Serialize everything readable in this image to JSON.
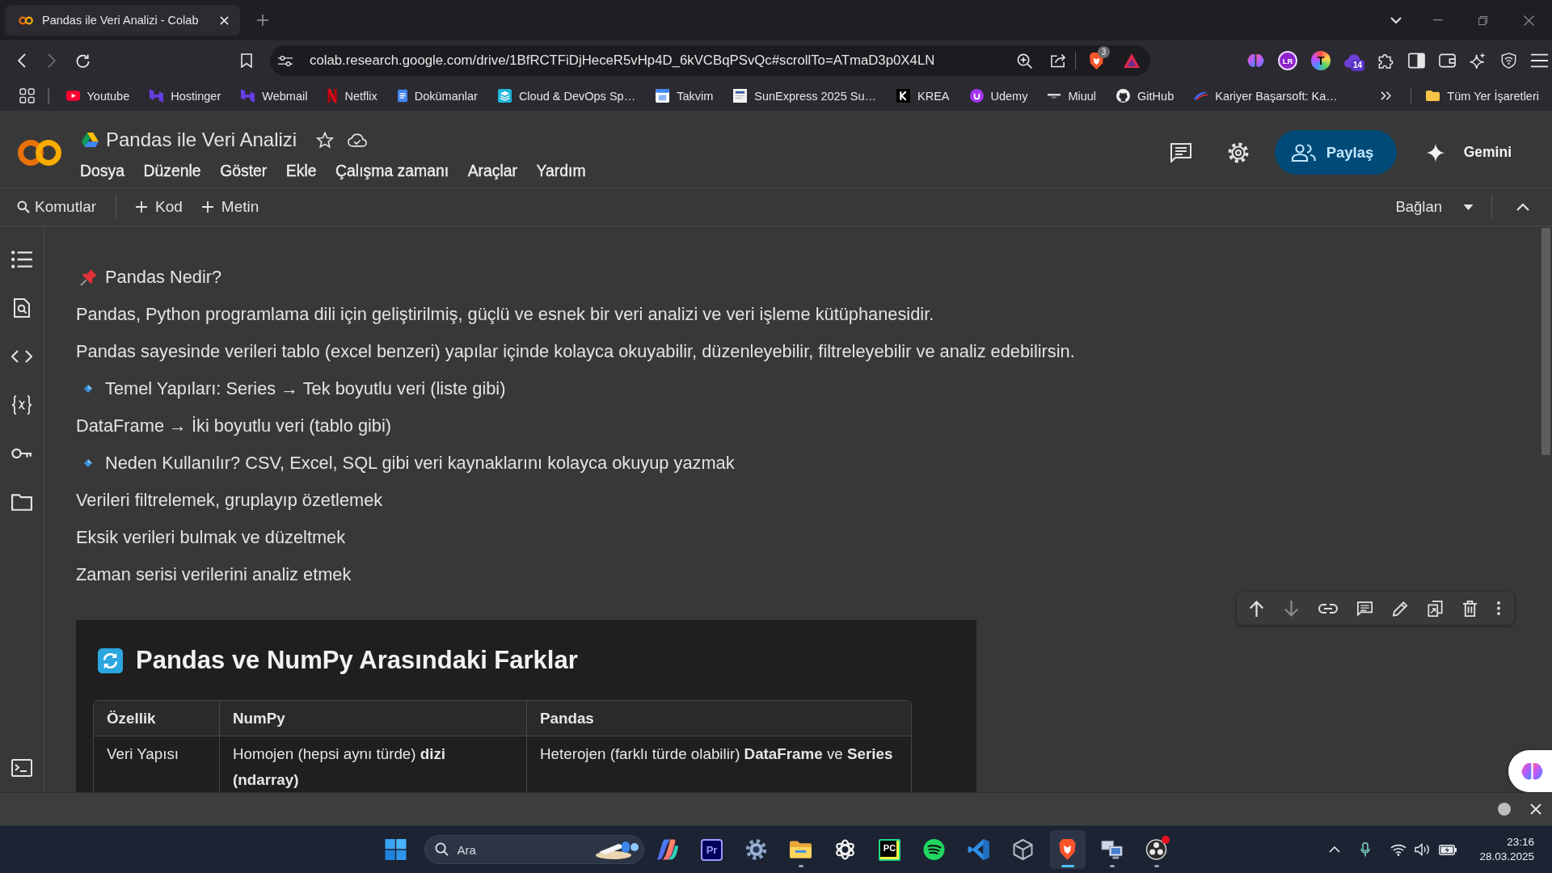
{
  "browser": {
    "tabs": [
      {
        "title": "Pandas ile Veri Analizi - Colab",
        "selected": true
      }
    ],
    "can_go_forward": false,
    "address_bar": {
      "value": "colab.research.google.com/drive/1BfRCTFiDjHeceR5vHp4D_6kVCBqPSvQc#scrollTo=ATmaD3p0X4LN"
    },
    "shields_badge": "3",
    "extensions": [
      {
        "kind": "brain"
      },
      {
        "kind": "ring-monogram",
        "label": "LR"
      },
      {
        "kind": "gradient-monogram",
        "label": "T"
      },
      {
        "kind": "cloud",
        "badge": "14"
      }
    ],
    "bookmarks": [
      {
        "label": "Youtube",
        "kind": "play"
      },
      {
        "label": "Hostinger",
        "kind": "h-mark"
      },
      {
        "label": "Webmail",
        "kind": "h-mark"
      },
      {
        "label": "Netflix",
        "kind": "n-mark"
      },
      {
        "label": "Dokümanlar",
        "kind": "document"
      },
      {
        "label": "Cloud & DevOps Sp…",
        "kind": "layers"
      },
      {
        "label": "Takvim",
        "kind": "calendar"
      },
      {
        "label": "SunExpress 2025 Su…",
        "kind": "page"
      },
      {
        "label": "KREA",
        "kind": "k-tile"
      },
      {
        "label": "Udemy",
        "kind": "u-disc"
      },
      {
        "label": "Miuul",
        "kind": "dash"
      },
      {
        "label": "GitHub",
        "kind": "cat"
      },
      {
        "label": "Kariyer Başarsoft: Ka…",
        "kind": "swoosh"
      }
    ],
    "all_bookmarks_folder": "Tüm Yer İşaretleri"
  },
  "notebook": {
    "title": "Pandas ile Veri Analizi",
    "starred": false,
    "menu": [
      "Dosya",
      "Düzenle",
      "Göster",
      "Ekle",
      "Çalışma zamanı",
      "Araçlar",
      "Yardım"
    ],
    "share_button": "Paylaş",
    "gemini_button": "Gemini",
    "toolbar": {
      "commands": "Komutlar",
      "add_code": "Kod",
      "add_text": "Metin",
      "connect": "Bağlan"
    }
  },
  "markdown_cell": {
    "toolbar": [
      {
        "kind": "up",
        "disabled": false
      },
      {
        "kind": "down",
        "disabled": true
      },
      {
        "kind": "link",
        "disabled": false
      },
      {
        "kind": "comment",
        "disabled": false
      },
      {
        "kind": "edit",
        "disabled": false
      },
      {
        "kind": "mirror",
        "disabled": false
      },
      {
        "kind": "delete",
        "disabled": false
      },
      {
        "kind": "more",
        "disabled": false
      }
    ],
    "lines": [
      {
        "kind": "pinned",
        "text": "Pandas Nedir?"
      },
      {
        "kind": "plain",
        "text": "Pandas, Python programlama dili için geliştirilmiş, güçlü ve esnek bir veri analizi ve veri işleme kütüphanesidir."
      },
      {
        "kind": "plain",
        "text": "Pandas sayesinde verileri tablo (excel benzeri) yapılar içinde kolayca okuyabilir, düzenleyebilir, filtreleyebilir ve analiz edebilirsin."
      },
      {
        "kind": "bullet",
        "text": "Temel Yapıları: Series → Tek boyutlu veri (liste gibi)"
      },
      {
        "kind": "plain",
        "text": "DataFrame → İki boyutlu veri (tablo gibi)"
      },
      {
        "kind": "bullet",
        "text": "Neden Kullanılır? CSV, Excel, SQL gibi veri kaynaklarını kolayca okuyup yazmak"
      },
      {
        "kind": "plain",
        "text": "Verileri filtrelemek, gruplayıp özetlemek"
      },
      {
        "kind": "plain",
        "text": "Eksik verileri bulmak ve düzeltmek"
      },
      {
        "kind": "plain",
        "text": "Zaman serisi verilerini analiz etmek"
      }
    ],
    "image": {
      "title": "Pandas ve NumPy Arasındaki Farklar",
      "table": {
        "columns": [
          "Özellik",
          "NumPy",
          "Pandas"
        ],
        "rows": [
          [
            "Veri Yapısı",
            "Homojen (hepsi aynı türde) **dizi (ndarray)**",
            "Heterojen (farklı türde olabilir) **DataFrame** ve **Series**"
          ]
        ]
      }
    }
  },
  "taskbar": {
    "search": {
      "placeholder": "Ara"
    },
    "apps": [
      {
        "kind": "swirl",
        "running": false,
        "selected": false,
        "notification": false
      },
      {
        "kind": "outline-tile",
        "label": "Pr",
        "running": false,
        "selected": false,
        "notification": false
      },
      {
        "kind": "gear",
        "running": false,
        "selected": false,
        "notification": false
      },
      {
        "kind": "folder",
        "running": true,
        "selected": false,
        "notification": false
      },
      {
        "kind": "knot",
        "running": false,
        "selected": false,
        "notification": false
      },
      {
        "kind": "gradient-tile",
        "label": "PC",
        "running": false,
        "selected": false,
        "notification": false
      },
      {
        "kind": "waves-disc",
        "running": false,
        "selected": false,
        "notification": false
      },
      {
        "kind": "ribbon",
        "running": false,
        "selected": false,
        "notification": false
      },
      {
        "kind": "cube",
        "running": false,
        "selected": false,
        "notification": false
      },
      {
        "kind": "lion",
        "running": true,
        "selected": true,
        "notification": false
      },
      {
        "kind": "computers",
        "running": true,
        "selected": false,
        "notification": false
      },
      {
        "kind": "aperture",
        "running": true,
        "selected": false,
        "notification": true
      }
    ],
    "time": "23:16",
    "date": "28.03.2025"
  }
}
